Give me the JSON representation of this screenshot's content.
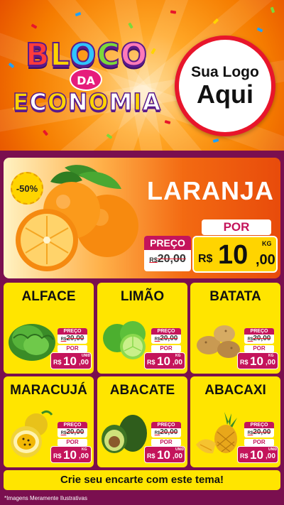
{
  "header": {
    "title_line1": [
      "B",
      "L",
      "O",
      "C",
      "O"
    ],
    "title_da": "DA",
    "title_line2": [
      "E",
      "C",
      "O",
      "N",
      "O",
      "M",
      "I",
      "A"
    ],
    "brand_line1": "Sua Logo",
    "brand_line2": "Aqui"
  },
  "hero": {
    "discount_badge": "-50%",
    "name": "LARANJA",
    "preco_label": "PREÇO",
    "old_currency": "R$",
    "old_price": "20,00",
    "por_label": "POR",
    "currency": "R$",
    "price_int": "10",
    "price_dec": ",00",
    "unit": "KG"
  },
  "products": [
    {
      "name": "ALFACE",
      "preco_label": "PREÇO",
      "old_currency": "R$",
      "old_price": "20,00",
      "por_label": "POR",
      "currency": "R$",
      "price_int": "10",
      "price_dec": ",00",
      "unit": "UNID"
    },
    {
      "name": "LIMÃO",
      "preco_label": "PREÇO",
      "old_currency": "R$",
      "old_price": "20,00",
      "por_label": "POR",
      "currency": "R$",
      "price_int": "10",
      "price_dec": ",00",
      "unit": "KG"
    },
    {
      "name": "BATATA",
      "preco_label": "PREÇO",
      "old_currency": "R$",
      "old_price": "20,00",
      "por_label": "POR",
      "currency": "R$",
      "price_int": "10",
      "price_dec": ",00",
      "unit": "KG"
    },
    {
      "name": "MARACUJÁ",
      "preco_label": "PREÇO",
      "old_currency": "R$",
      "old_price": "20,00",
      "por_label": "POR",
      "currency": "R$",
      "price_int": "10",
      "price_dec": ",00",
      "unit": "KG"
    },
    {
      "name": "ABACATE",
      "preco_label": "PREÇO",
      "old_currency": "R$",
      "old_price": "20,00",
      "por_label": "POR",
      "currency": "R$",
      "price_int": "10",
      "price_dec": ",00",
      "unit": "UNID"
    },
    {
      "name": "ABACAXI",
      "preco_label": "PREÇO",
      "old_currency": "R$",
      "old_price": "20,00",
      "por_label": "POR",
      "currency": "R$",
      "price_int": "10",
      "price_dec": ",00",
      "unit": "UNID"
    }
  ],
  "footer": {
    "cta": "Crie seu encarte com este tema!",
    "disclaimer": "*Imagens Meramente Ilustrativas"
  },
  "colors": {
    "background": "#7a0f4f",
    "accent_yellow": "#ffe500",
    "price_magenta": "#c4145b",
    "hero_orange": "#f36a12",
    "strike_red": "#e8152b"
  }
}
